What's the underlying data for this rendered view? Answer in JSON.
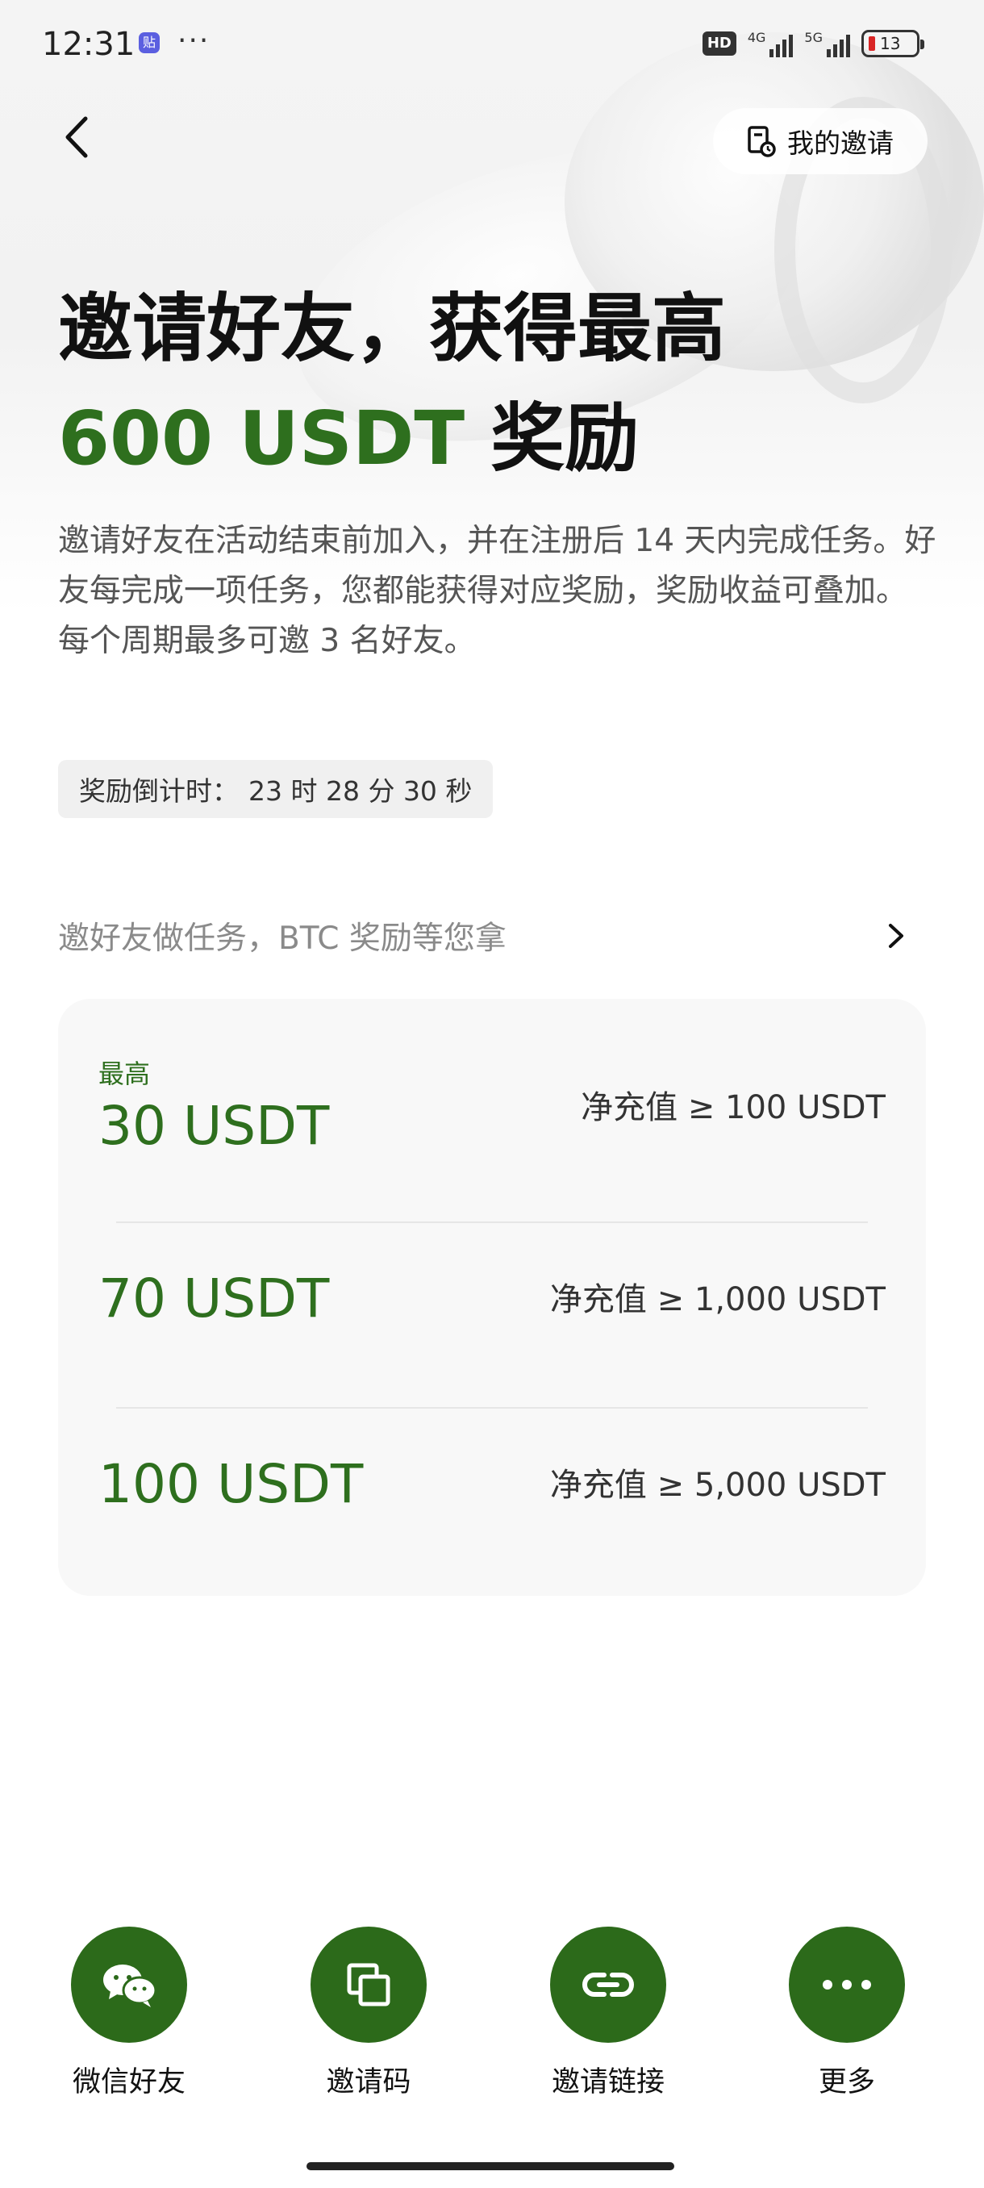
{
  "status_bar": {
    "time": "12:31",
    "app_badge": "贴",
    "more": "···",
    "hd_label": "HD",
    "network_1": "4G",
    "network_2": "5G",
    "battery_level": "13"
  },
  "nav": {
    "back_icon": "chevron-left-icon",
    "my_invite_label": "我的邀请",
    "my_invite_icon": "invite-record-icon"
  },
  "headline": {
    "line1": "邀请好友，获得最高",
    "accent": "600 USDT",
    "line2_suffix": " 奖励"
  },
  "description": {
    "para1": "邀请好友在活动结束前加入，并在注册后 14 天内完成任务。好友每完成一项任务，您都能获得对应奖励，奖励收益可叠加。",
    "para2": "每个周期最多可邀 3 名好友。"
  },
  "countdown": {
    "label": "奖励倒计时：",
    "value": "23 时 28 分 30 秒"
  },
  "task_link": {
    "label": "邀好友做任务，BTC 奖励等您拿",
    "icon": "chevron-right-icon"
  },
  "rewards": [
    {
      "tag": "最高",
      "amount": "30 USDT",
      "condition": "净充值 ≥ 100 USDT"
    },
    {
      "tag": "",
      "amount": "70 USDT",
      "condition": "净充值 ≥ 1,000 USDT"
    },
    {
      "tag": "",
      "amount": "100 USDT",
      "condition": "净充值 ≥ 5,000 USDT"
    }
  ],
  "share": [
    {
      "label": "微信好友",
      "icon": "wechat-icon"
    },
    {
      "label": "邀请码",
      "icon": "copy-icon"
    },
    {
      "label": "邀请链接",
      "icon": "link-icon"
    },
    {
      "label": "更多",
      "icon": "more-icon"
    }
  ],
  "colors": {
    "accent_green": "#2e6f1e",
    "button_green": "#2c6a1a"
  }
}
